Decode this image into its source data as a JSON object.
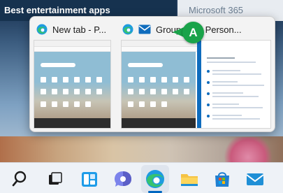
{
  "background": {
    "left_banner": "Best entertainment apps",
    "right_banner": "Microsoft 365"
  },
  "previews": [
    {
      "title": "New tab - P...",
      "app_icon": "edge-icon"
    },
    {
      "title": "Group | N... Person...",
      "app_icon": "mail-icon"
    }
  ],
  "callout": {
    "label": "A"
  },
  "taskbar": {
    "icons": [
      "search-icon",
      "task-view-icon",
      "widgets-icon",
      "teams-chat-icon",
      "edge-icon",
      "file-explorer-icon",
      "microsoft-store-icon",
      "mail-icon"
    ],
    "active": "edge-icon"
  },
  "colors": {
    "callout": "#1aa34a",
    "accent": "#0067c0",
    "outlook_blue": "#0f6cbd"
  }
}
